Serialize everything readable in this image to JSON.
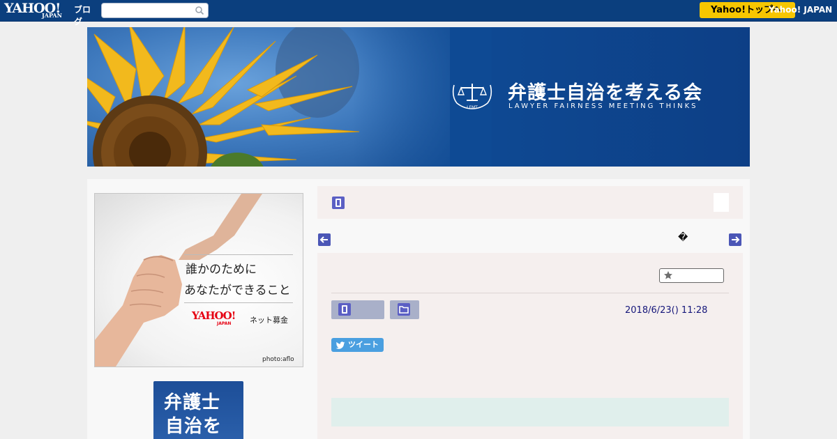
{
  "topbar": {
    "logo_text": "YAHOO!",
    "logo_sub": "JAPAN",
    "blog_label": "ブログ",
    "search_placeholder": "",
    "yahoo_button_label": "Yahoo!トップへ",
    "yahoo_link": "Yahoo! JAPAN"
  },
  "header": {
    "site_title": "弁護士自治を考える会",
    "site_subtitle": "Lawyer Fairness Meeting Thinks",
    "emblem_text": "LFMT"
  },
  "sidebar": {
    "ad": {
      "line1": "誰かのために",
      "line2": "あなたができること",
      "brand": "YAHOO!",
      "brand_sub": "JAPAN",
      "service": "ネット募金",
      "credit": "photo:aflo"
    },
    "book": {
      "line1": "弁護士",
      "line2": "自治を"
    }
  },
  "main": {
    "nav_glyph": "�",
    "entry": {
      "date": "2018/6/23()  11:28",
      "tweet_label": "ツイート"
    }
  },
  "colors": {
    "topbar": "#0b3f7e",
    "accent_yellow": "#f7c600",
    "icon_purple": "#5b5fc4",
    "date_text": "#15167a",
    "tweet_blue": "#4a9fe0"
  }
}
